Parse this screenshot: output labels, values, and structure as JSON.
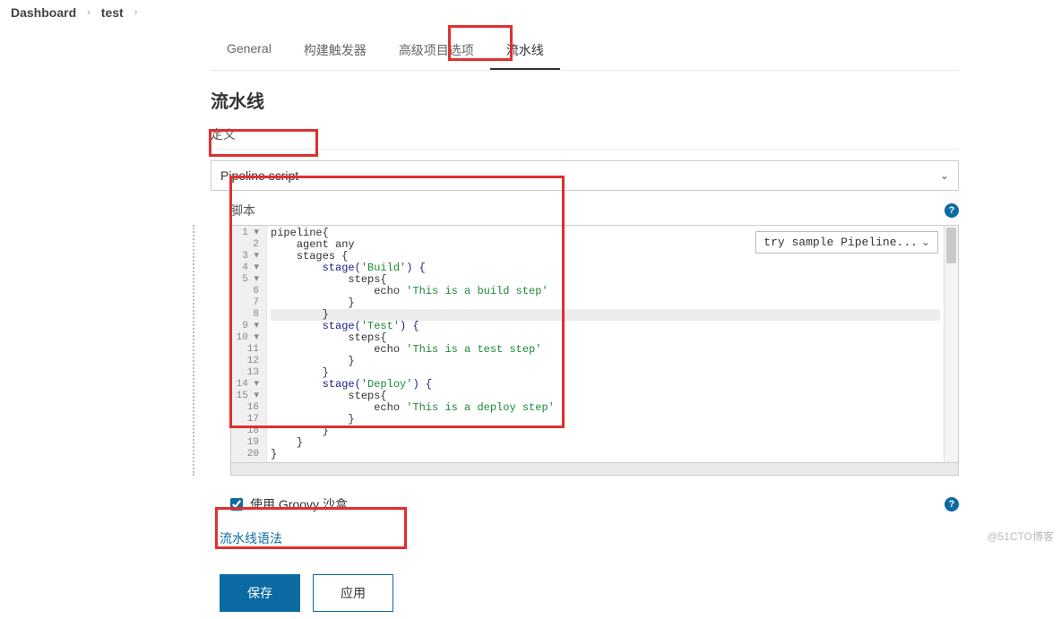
{
  "breadcrumb": {
    "dashboard": "Dashboard",
    "test": "test"
  },
  "tabs": {
    "general": "General",
    "triggers": "构建触发器",
    "advanced": "高级项目选项",
    "pipeline": "流水线"
  },
  "section": {
    "title": "流水线",
    "definition_label": "定义",
    "definition_value": "Pipeline script",
    "script_label": "脚本",
    "sample_select": "try sample Pipeline...",
    "sandbox_label": "使用 Groovy 沙盒",
    "syntax_link": "流水线语法"
  },
  "code": {
    "gutter": [
      "1 ▾",
      "2",
      "3 ▾",
      "4 ▾",
      "5 ▾",
      "6",
      "7",
      "8",
      "9 ▾",
      "10 ▾",
      "11",
      "12",
      "13",
      "14 ▾",
      "15 ▾",
      "16",
      "17",
      "18",
      "19",
      "20"
    ],
    "lines": [
      {
        "indent": 0,
        "tokens": [
          {
            "t": "pipeline{",
            "c": "kw"
          }
        ]
      },
      {
        "indent": 1,
        "tokens": [
          {
            "t": "agent any",
            "c": "kw"
          }
        ]
      },
      {
        "indent": 1,
        "tokens": [
          {
            "t": "stages {",
            "c": "kw"
          }
        ]
      },
      {
        "indent": 2,
        "tokens": [
          {
            "t": "stage(",
            "c": "fn"
          },
          {
            "t": "'Build'",
            "c": "str"
          },
          {
            "t": ") {",
            "c": "fn"
          }
        ]
      },
      {
        "indent": 3,
        "tokens": [
          {
            "t": "steps{",
            "c": "kw"
          }
        ]
      },
      {
        "indent": 4,
        "tokens": [
          {
            "t": "echo ",
            "c": "kw"
          },
          {
            "t": "'This is a build step'",
            "c": "str"
          }
        ]
      },
      {
        "indent": 3,
        "tokens": [
          {
            "t": "}",
            "c": "punc"
          }
        ]
      },
      {
        "indent": 2,
        "tokens": [
          {
            "t": "}",
            "c": "punc"
          }
        ],
        "hl": true
      },
      {
        "indent": 2,
        "tokens": [
          {
            "t": "stage(",
            "c": "fn"
          },
          {
            "t": "'Test'",
            "c": "str"
          },
          {
            "t": ") {",
            "c": "fn"
          }
        ]
      },
      {
        "indent": 3,
        "tokens": [
          {
            "t": "steps{",
            "c": "kw"
          }
        ]
      },
      {
        "indent": 4,
        "tokens": [
          {
            "t": "echo ",
            "c": "kw"
          },
          {
            "t": "'This is a test step'",
            "c": "str"
          }
        ]
      },
      {
        "indent": 3,
        "tokens": [
          {
            "t": "}",
            "c": "punc"
          }
        ]
      },
      {
        "indent": 2,
        "tokens": [
          {
            "t": "}",
            "c": "punc"
          }
        ]
      },
      {
        "indent": 2,
        "tokens": [
          {
            "t": "stage(",
            "c": "fn"
          },
          {
            "t": "'Deploy'",
            "c": "str"
          },
          {
            "t": ") {",
            "c": "fn"
          }
        ]
      },
      {
        "indent": 3,
        "tokens": [
          {
            "t": "steps{",
            "c": "kw"
          }
        ]
      },
      {
        "indent": 4,
        "tokens": [
          {
            "t": "echo ",
            "c": "kw"
          },
          {
            "t": "'This is a deploy step'",
            "c": "str"
          }
        ]
      },
      {
        "indent": 3,
        "tokens": [
          {
            "t": "}",
            "c": "punc"
          }
        ]
      },
      {
        "indent": 2,
        "tokens": [
          {
            "t": "}",
            "c": "punc"
          }
        ]
      },
      {
        "indent": 1,
        "tokens": [
          {
            "t": "}",
            "c": "punc"
          }
        ]
      },
      {
        "indent": 0,
        "tokens": [
          {
            "t": "}",
            "c": "punc"
          }
        ]
      }
    ]
  },
  "buttons": {
    "save": "保存",
    "apply": "应用"
  },
  "watermark": "@51CTO博客"
}
